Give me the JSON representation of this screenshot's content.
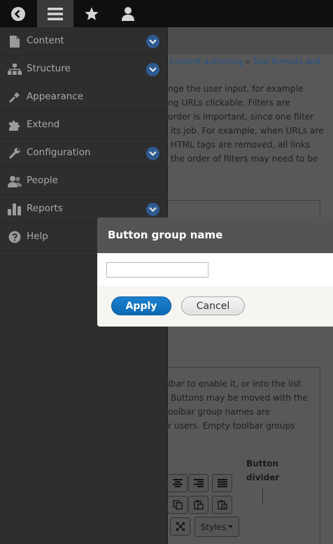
{
  "toolbar": {
    "back_icon": "back-circle-icon",
    "menu_icon": "hamburger-icon",
    "shortcuts_icon": "star-icon",
    "user_icon": "user-icon"
  },
  "menu": {
    "items": [
      {
        "label": "Content",
        "icon": "file-icon",
        "expandable": true
      },
      {
        "label": "Structure",
        "icon": "sitemap-icon",
        "expandable": true
      },
      {
        "label": "Appearance",
        "icon": "paintbrush-icon",
        "expandable": false
      },
      {
        "label": "Extend",
        "icon": "puzzle-icon",
        "expandable": false
      },
      {
        "label": "Configuration",
        "icon": "wrench-icon",
        "expandable": true
      },
      {
        "label": "People",
        "icon": "people-icon",
        "expandable": false
      },
      {
        "label": "Reports",
        "icon": "bar-chart-icon",
        "expandable": true
      },
      {
        "label": "Help",
        "icon": "help-icon",
        "expandable": false
      }
    ]
  },
  "page": {
    "breadcrumb": [
      "Content authoring",
      "Text formats and"
    ],
    "breadcrumb_sep": "»",
    "intro_lines": [
      "nge the user input, for example",
      "ng URLs clickable. Filters are",
      "order is important, since one filter",
      " its job. For example, when URLs are",
      " HTML tags are removed, all links",
      " the order of filters may need to be"
    ],
    "toolbar_help_lines": [
      {
        "em": "lbar",
        "rest": " to enable it, or into the list"
      },
      {
        "em": "",
        "rest": " Buttons may be moved with the"
      },
      {
        "em": "",
        "rest": "oolbar group names are"
      },
      {
        "em": "",
        "rest": "r users. Empty toolbar groups"
      }
    ],
    "button_divider_label": [
      "Button",
      "divider"
    ],
    "styles_label": "Styles"
  },
  "dialog": {
    "title": "Button group name",
    "input_value": "",
    "apply_label": "Apply",
    "cancel_label": "Cancel",
    "colors": {
      "apply": "#0f71c1",
      "title_bar": "#545454"
    }
  }
}
